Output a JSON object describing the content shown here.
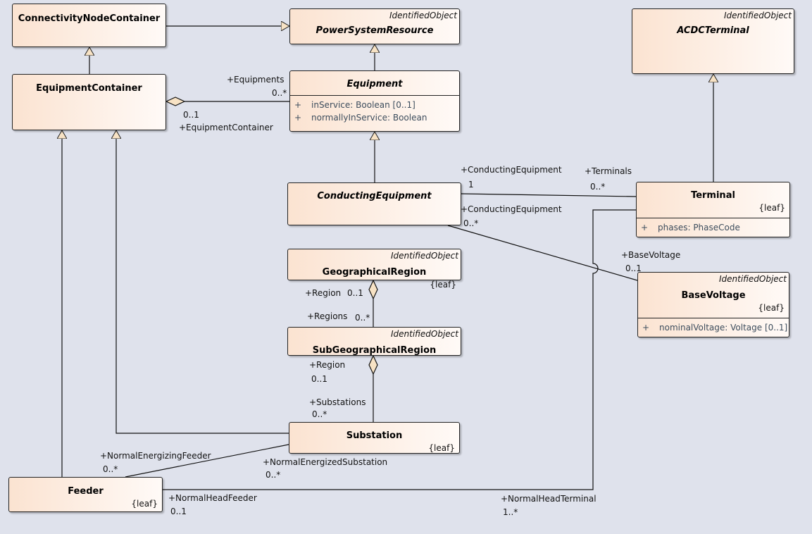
{
  "classes": {
    "cnc": {
      "name": "ConnectivityNodeContainer"
    },
    "psr": {
      "name": "PowerSystemResource",
      "stereotype": "IdentifiedObject"
    },
    "acdc": {
      "name": "ACDCTerminal",
      "stereotype": "IdentifiedObject"
    },
    "eqc": {
      "name": "EquipmentContainer"
    },
    "eq": {
      "name": "Equipment",
      "attrs": [
        {
          "vis": "+",
          "text": "inService: Boolean [0..1]"
        },
        {
          "vis": "+",
          "text": "normallyInService: Boolean"
        }
      ]
    },
    "ce": {
      "name": "ConductingEquipment"
    },
    "term": {
      "name": "Terminal",
      "tag": "{leaf}",
      "attrs": [
        {
          "vis": "+",
          "text": "phases: PhaseCode"
        }
      ]
    },
    "geo": {
      "name": "GeographicalRegion",
      "stereotype": "IdentifiedObject",
      "tag": "{leaf}"
    },
    "subgeo": {
      "name": "SubGeographicalRegion",
      "stereotype": "IdentifiedObject"
    },
    "bv": {
      "name": "BaseVoltage",
      "stereotype": "IdentifiedObject",
      "tag": "{leaf}",
      "attrs": [
        {
          "vis": "+",
          "text": "nominalVoltage: Voltage [0..1]"
        }
      ]
    },
    "sub": {
      "name": "Substation",
      "tag": "{leaf}"
    },
    "feeder": {
      "name": "Feeder",
      "tag": "{leaf}"
    }
  },
  "labels": {
    "equipments": "+Equipments",
    "equipments_m": "0..*",
    "eqcont_m": "0..1",
    "eqcont": "+EquipmentContainer",
    "ce1": "+ConductingEquipment",
    "ce1_m": "1",
    "terminals": "+Terminals",
    "terminals_m": "0..*",
    "ce2": "+ConductingEquipment",
    "ce2_m": "0..*",
    "bv": "+BaseVoltage",
    "bv_m": "0..1",
    "region1": "+Region",
    "region1_m": "0..1",
    "regions": "+Regions",
    "regions_m": "0..*",
    "region2": "+Region",
    "region2_m": "0..1",
    "substations": "+Substations",
    "substations_m": "0..*",
    "nef": "+NormalEnergizingFeeder",
    "nef_m": "0..*",
    "nes": "+NormalEnergizedSubstation",
    "nes_m": "0..*",
    "nhf": "+NormalHeadFeeder",
    "nhf_m": "0..1",
    "nht": "+NormalHeadTerminal",
    "nht_m": "1..*"
  }
}
